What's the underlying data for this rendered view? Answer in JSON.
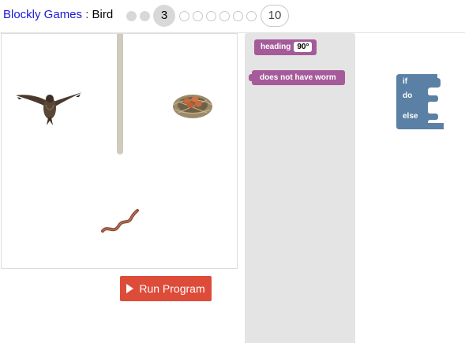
{
  "header": {
    "app_name": "Blockly Games",
    "separator": ":",
    "level_name": "Bird",
    "levels": {
      "current": "3",
      "last": "10",
      "completed": 2,
      "total": 10
    }
  },
  "stage": {
    "sprites": {
      "bird": "bird-icon",
      "nest": "nest-icon",
      "worm": "worm-icon"
    }
  },
  "controls": {
    "run_label": "Run Program",
    "run_icon": "play-icon"
  },
  "toolbox": {
    "heading_block": {
      "label": "heading",
      "value": "90°"
    },
    "worm_block": {
      "label": "does not have worm"
    }
  },
  "workspace": {
    "if_block": {
      "if_label": "if",
      "do_label": "do",
      "else_label": "else"
    }
  },
  "colors": {
    "link": "#1a1ad6",
    "run_button": "#dd4b39",
    "logic_block": "#5b80a5",
    "bird_block": "#a55b99",
    "toolbox_bg": "#e4e4e4",
    "wall": "#cfcbbd"
  }
}
